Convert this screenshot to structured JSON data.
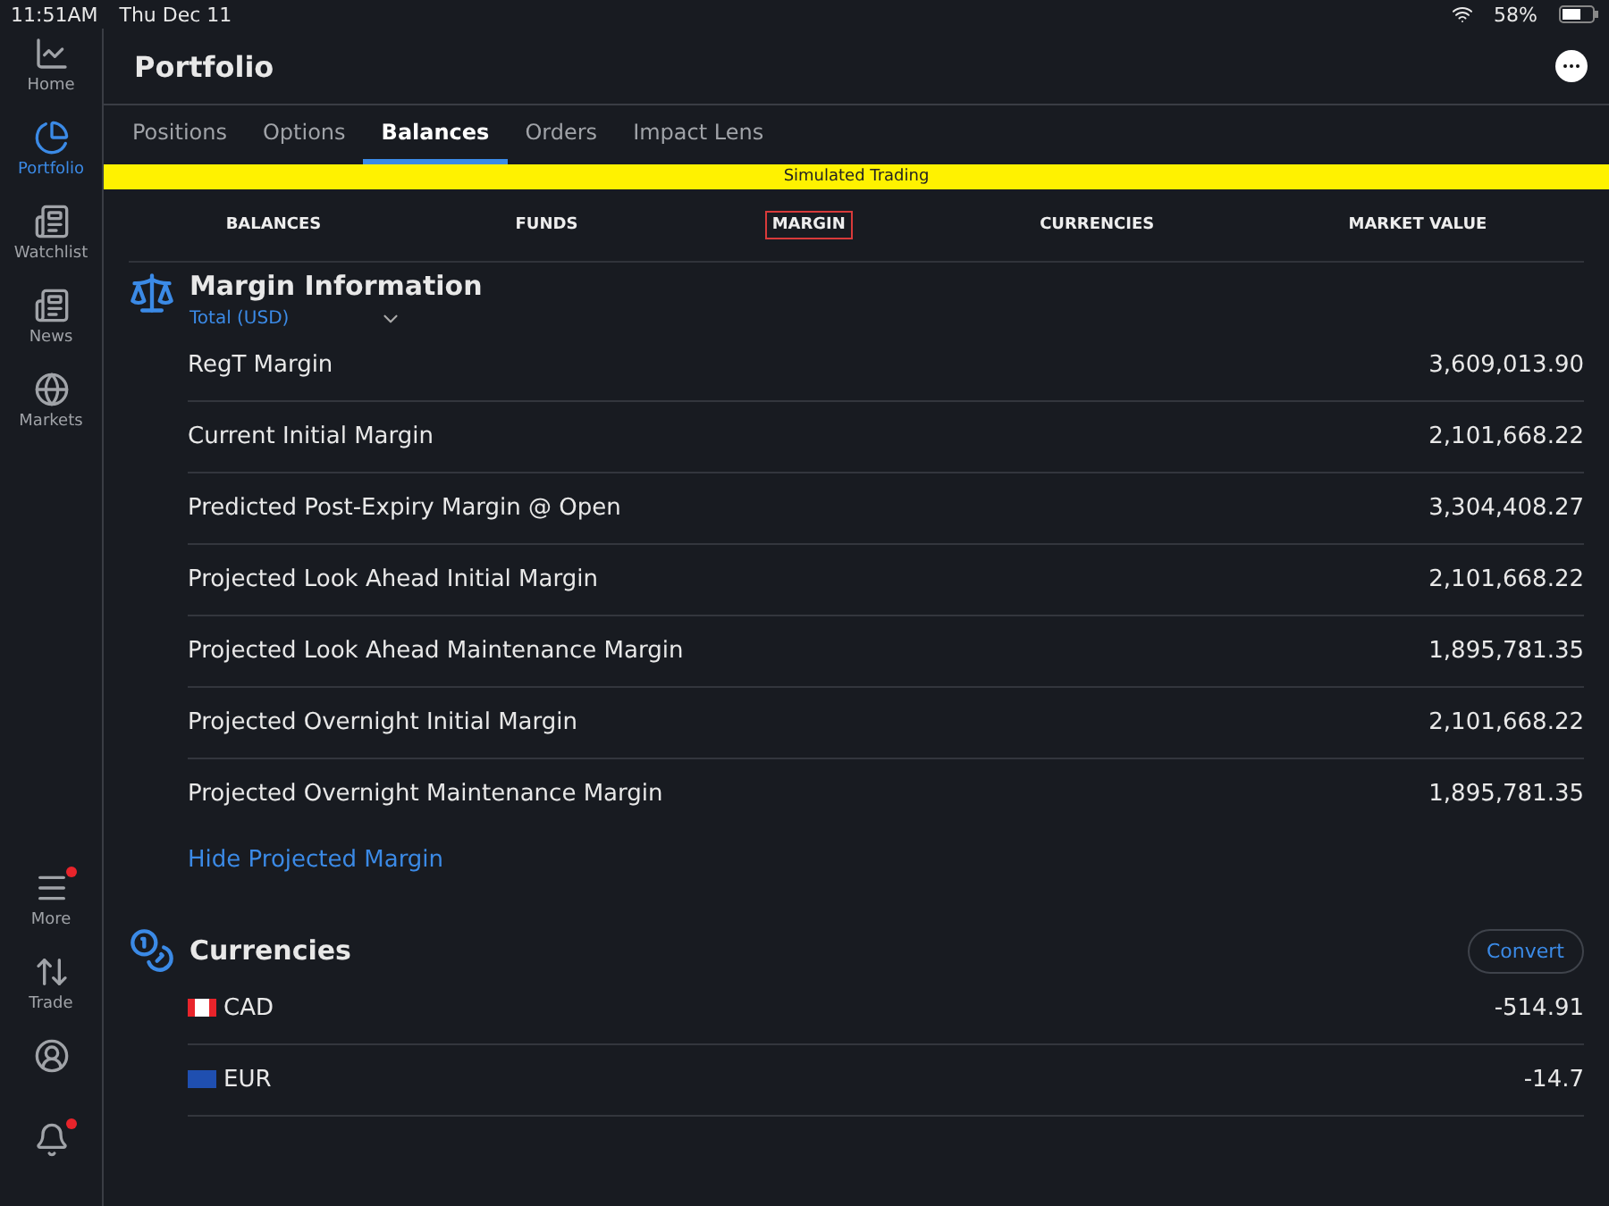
{
  "status_bar": {
    "time": "11:51AM",
    "date": "Thu Dec 11",
    "battery": "58%"
  },
  "sidebar": {
    "items": [
      {
        "kind": "home",
        "label": "Home",
        "selected": false,
        "badge": false
      },
      {
        "kind": "portfolio",
        "label": "Portfolio",
        "selected": true,
        "badge": false
      },
      {
        "kind": "watchlist",
        "label": "Watchlist",
        "selected": false,
        "badge": false
      },
      {
        "kind": "news",
        "label": "News",
        "selected": false,
        "badge": false
      },
      {
        "kind": "markets",
        "label": "Markets",
        "selected": false,
        "badge": false
      }
    ],
    "bottom_items": [
      {
        "kind": "more",
        "label": "More",
        "badge": true
      },
      {
        "kind": "trade",
        "label": "Trade",
        "badge": false
      },
      {
        "kind": "profile",
        "badge": false
      },
      {
        "kind": "bell",
        "badge": true
      }
    ]
  },
  "header": {
    "title": "Portfolio"
  },
  "tabs": [
    {
      "label": "Positions",
      "selected": false
    },
    {
      "label": "Options",
      "selected": false
    },
    {
      "label": "Balances",
      "selected": true
    },
    {
      "label": "Orders",
      "selected": false
    },
    {
      "label": "Impact Lens",
      "selected": false
    }
  ],
  "banner": "Simulated Trading",
  "sub_tabs": [
    {
      "label": "BALANCES",
      "selected": false
    },
    {
      "label": "FUNDS",
      "selected": false
    },
    {
      "label": "MARGIN",
      "selected": true
    },
    {
      "label": "CURRENCIES",
      "selected": false
    },
    {
      "label": "MARKET VALUE",
      "selected": false
    }
  ],
  "margin": {
    "title": "Margin Information",
    "selector": "Total (USD)",
    "rows": [
      {
        "label": "RegT Margin",
        "value": "3,609,013.90"
      },
      {
        "label": "Current Initial Margin",
        "value": "2,101,668.22"
      },
      {
        "label": "Predicted Post-Expiry Margin @ Open",
        "value": "3,304,408.27"
      },
      {
        "label": "Projected Look Ahead Initial Margin",
        "value": "2,101,668.22"
      },
      {
        "label": "Projected Look Ahead Maintenance Margin",
        "value": "1,895,781.35"
      },
      {
        "label": "Projected Overnight Initial Margin",
        "value": "2,101,668.22"
      },
      {
        "label": "Projected Overnight Maintenance Margin",
        "value": "1,895,781.35"
      }
    ],
    "link": "Hide Projected Margin"
  },
  "currencies": {
    "title": "Currencies",
    "button": "Convert",
    "rows": [
      {
        "kind": "ca",
        "code": "CAD",
        "value": "-514.91"
      },
      {
        "kind": "eu",
        "code": "EUR",
        "value": "-14.7"
      }
    ]
  }
}
